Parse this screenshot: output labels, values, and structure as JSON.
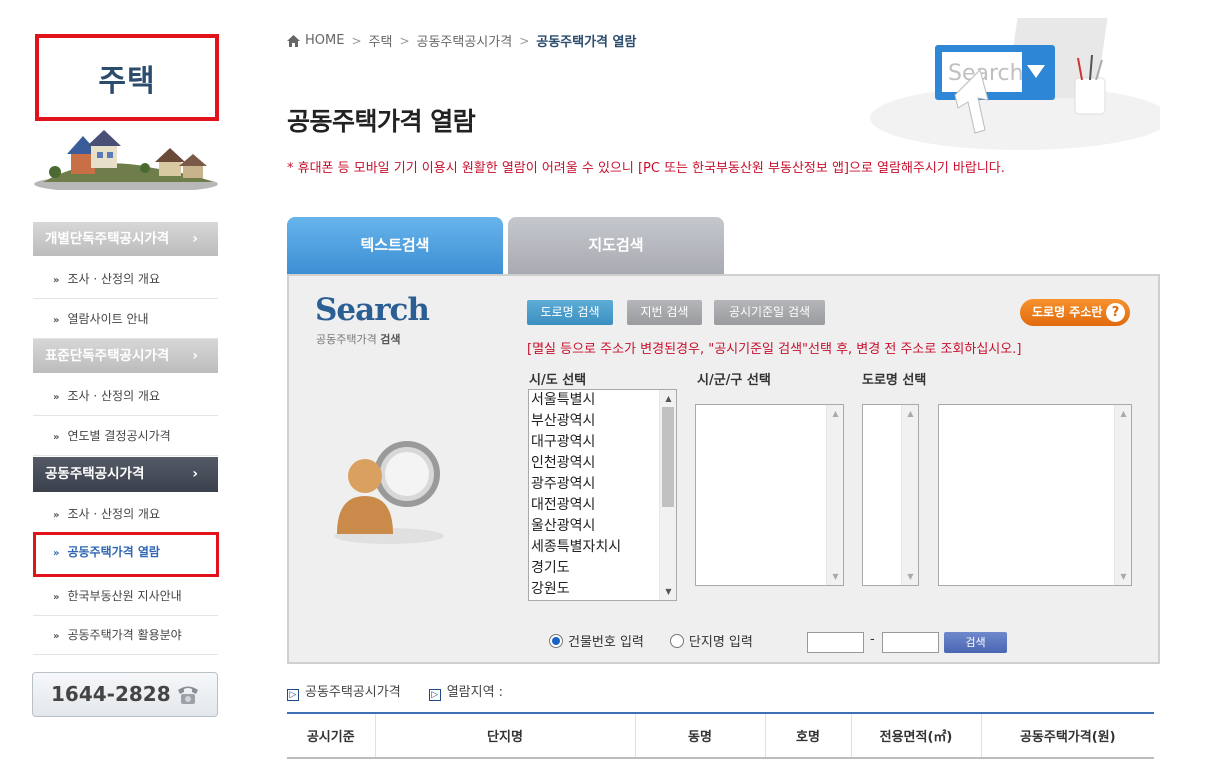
{
  "sidebar": {
    "section_title": "주택",
    "menu": [
      {
        "label": "개별단독주택공시가격",
        "arrow": "›",
        "children": [
          "조사 · 산정의 개요",
          "열람사이트 안내"
        ]
      },
      {
        "label": "표준단독주택공시가격",
        "arrow": "›",
        "children": [
          "조사 · 산정의 개요",
          "연도별 결정공시가격"
        ]
      },
      {
        "label": "공동주택공시가격",
        "arrow": "›",
        "children": [
          "조사 · 산정의 개요",
          "공동주택가격 열람",
          "한국부동산원 지사안내",
          "공동주택가격 활용분야"
        ]
      }
    ],
    "bullet": "»",
    "phone": "1644-2828"
  },
  "breadcrumb": {
    "home": "HOME",
    "sep": ">",
    "items": [
      "주택",
      "공동주택공시가격",
      "공동주택가격 열람"
    ]
  },
  "page": {
    "title": "공동주택가격 열람",
    "notice": "* 휴대폰 등 모바일 기기 이용시 원활한 열람이 어려울 수 있으니 [PC 또는 한국부동산원 부동산정보 앱]으로 열람해주시기 바랍니다."
  },
  "header_art": {
    "search_text": "Search"
  },
  "tabs": [
    "텍스트검색",
    "지도검색"
  ],
  "search_panel": {
    "logo": "Search",
    "logo_sub_plain": "공동주택가격 ",
    "logo_sub_bold": "검색",
    "buttons": {
      "road": "도로명 검색",
      "lot": "지번 검색",
      "date": "공시기준일 검색",
      "road_addr": "도로명 주소란",
      "help": "?"
    },
    "note": "[멸실 등으로 주소가 변경된경우, \"공시기준일 검색\"선택 후, 변경 전 주소로 조회하십시오.]",
    "labels": {
      "sido": "시/도 선택",
      "sigungu": "시/군/구 선택",
      "road": "도로명 선택"
    },
    "sido_options": [
      "서울특별시",
      "부산광역시",
      "대구광역시",
      "인천광역시",
      "광주광역시",
      "대전광역시",
      "울산광역시",
      "세종특별자치시",
      "경기도",
      "강원도"
    ],
    "radio": {
      "building": "건물번호 입력",
      "complex": "단지명 입력"
    },
    "dash": "-",
    "search_btn": "검색"
  },
  "info": {
    "price_label": "공동주택공시가격",
    "region_label": "열람지역 :",
    "marker": "▷"
  },
  "table": {
    "headers": [
      "공시기준",
      "단지명",
      "동명",
      "호명",
      "전용면적(㎡)",
      "공동주택가격(원)"
    ]
  },
  "colors": {
    "accent_red": "#e0131b",
    "tab_blue": "#3d8fd4",
    "notice_red": "#c8102e",
    "navy": "#2c4c6e"
  }
}
